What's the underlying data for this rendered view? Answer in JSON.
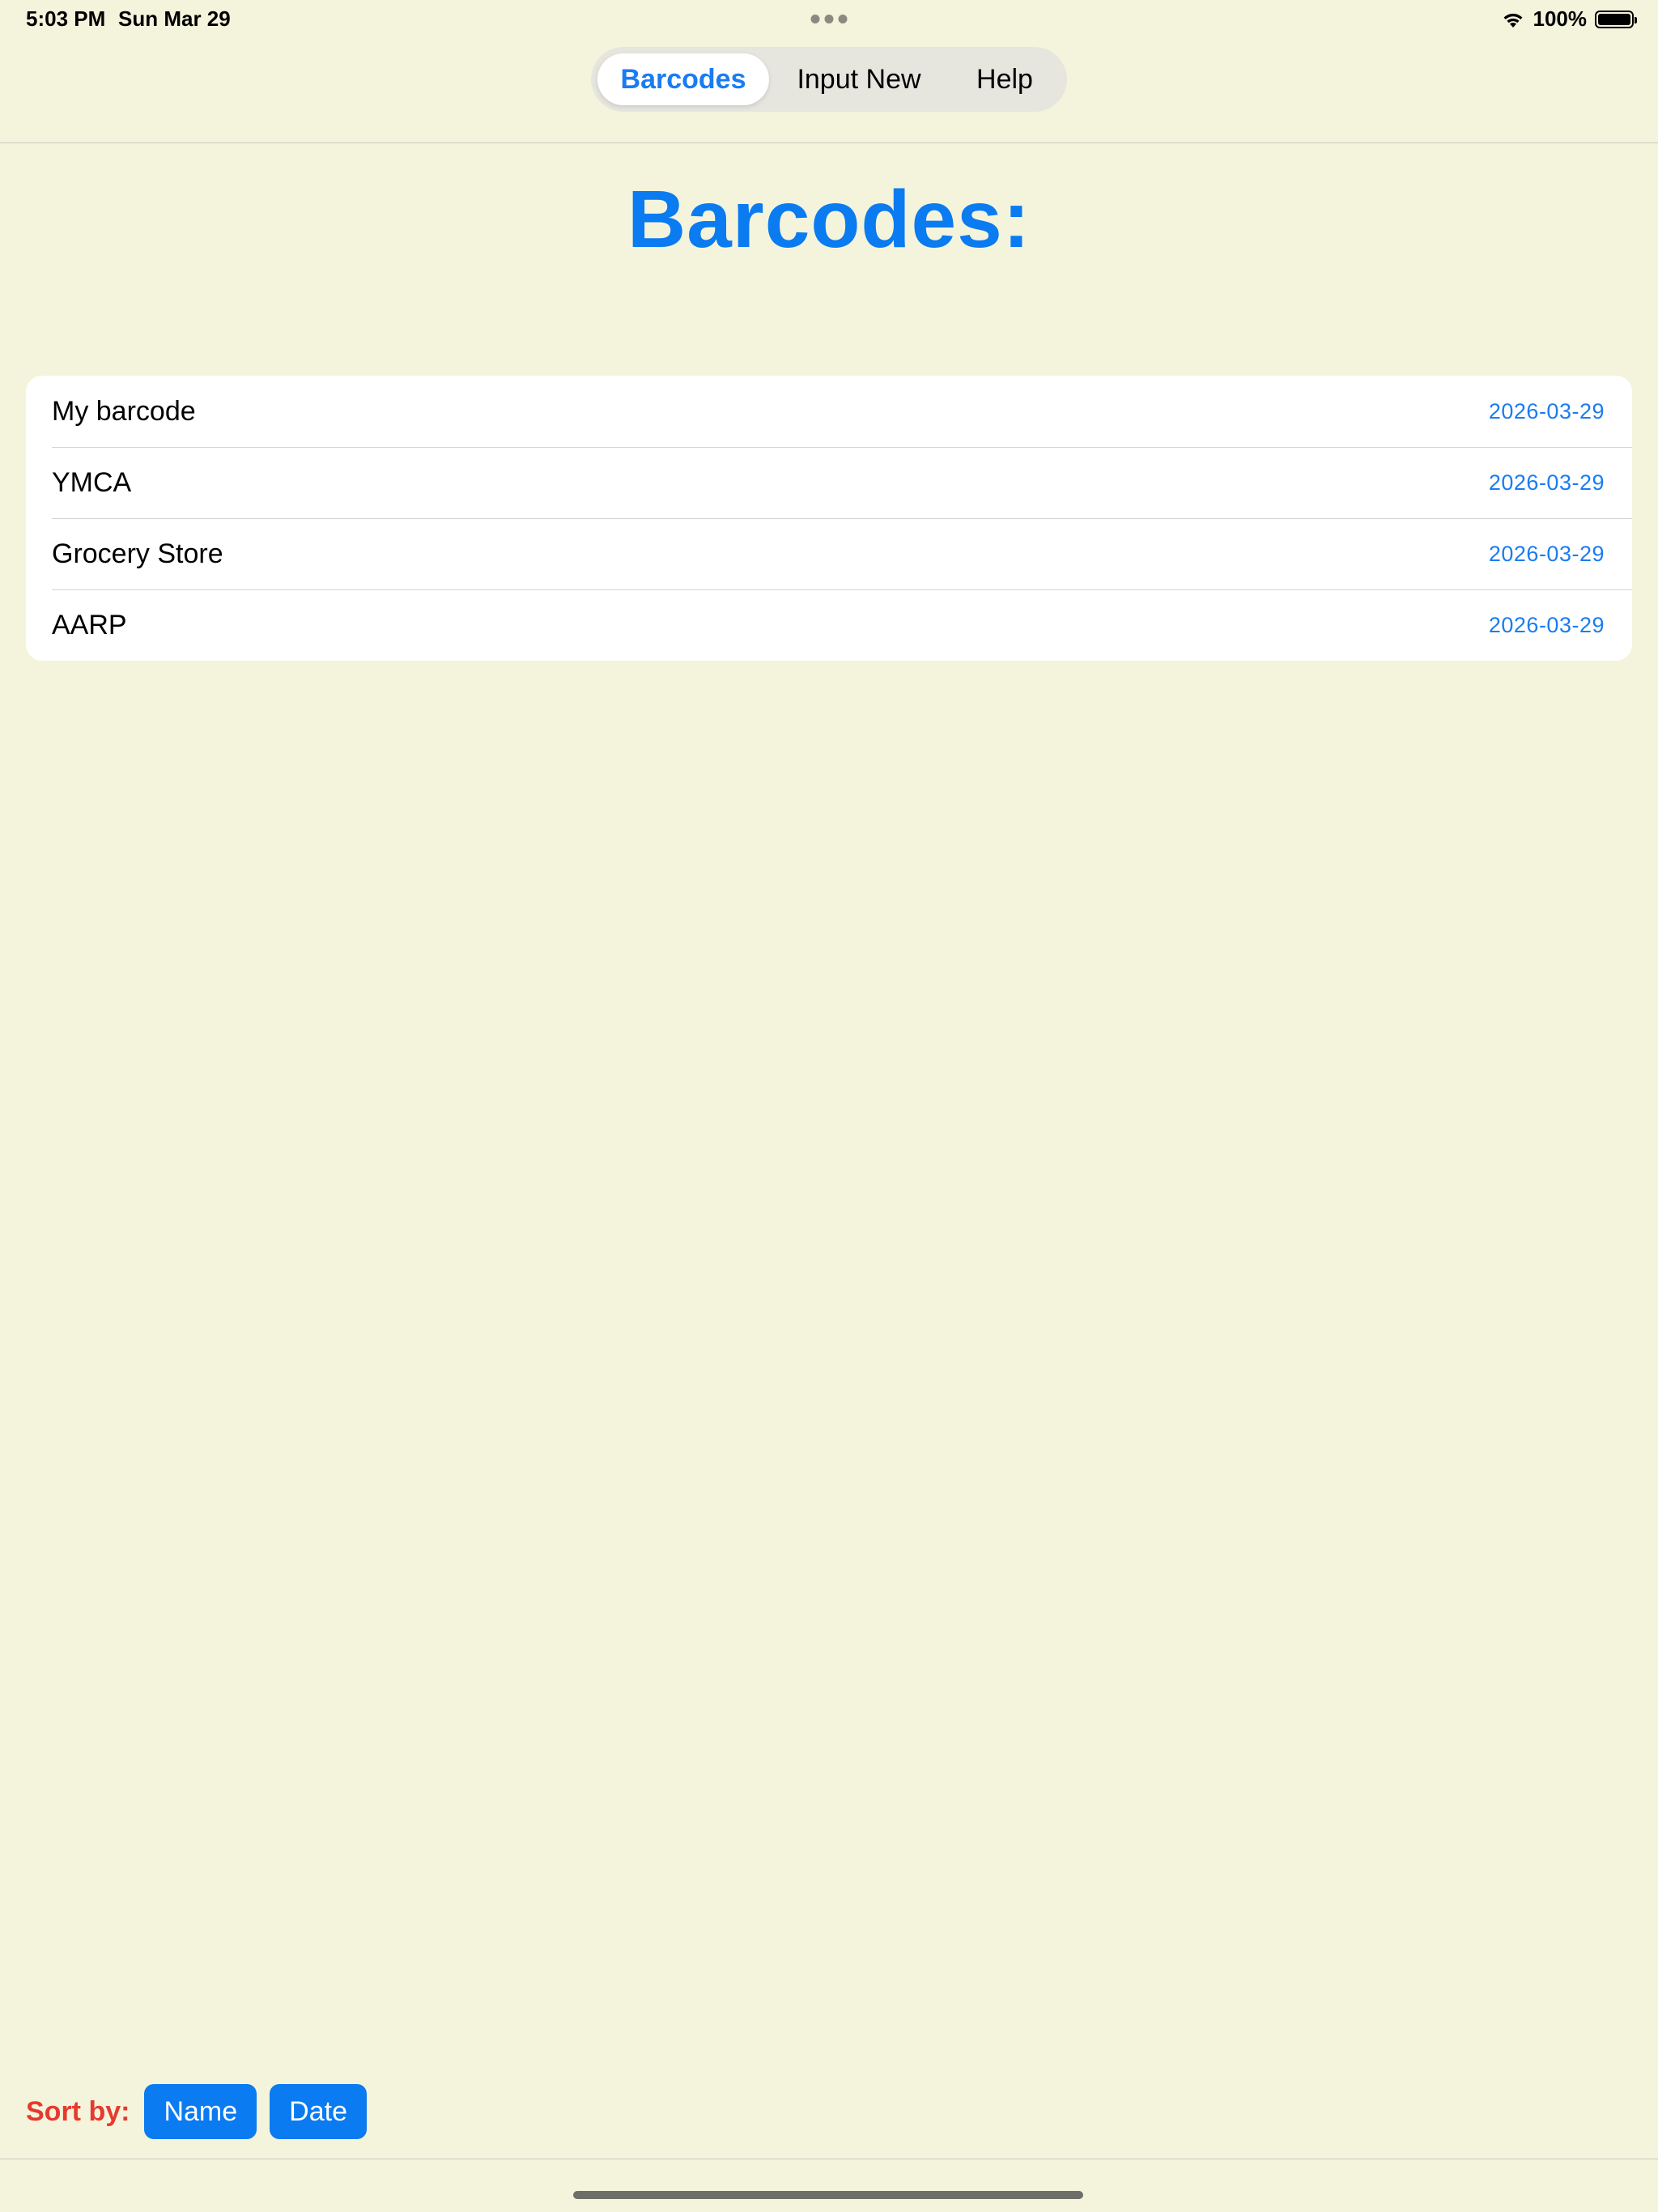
{
  "status_bar": {
    "time": "5:03 PM",
    "date": "Sun Mar 29",
    "battery_percent": "100%",
    "battery_level": 1.0,
    "icons": [
      "wifi-icon",
      "battery-icon",
      "multitask-dots-icon"
    ]
  },
  "tabs": [
    {
      "label": "Barcodes",
      "selected": true
    },
    {
      "label": "Input New",
      "selected": false
    },
    {
      "label": "Help",
      "selected": false
    }
  ],
  "page": {
    "title": "Barcodes:"
  },
  "barcodes": [
    {
      "name": "My barcode",
      "date": "2026-03-29"
    },
    {
      "name": "YMCA",
      "date": "2026-03-29"
    },
    {
      "name": "Grocery Store",
      "date": "2026-03-29"
    },
    {
      "name": "AARP",
      "date": "2026-03-29"
    }
  ],
  "sort": {
    "label": "Sort by:",
    "name_button": "Name",
    "date_button": "Date"
  },
  "colors": {
    "background": "#f4f4dc",
    "accent": "#0a7bf0",
    "sort_label": "#e8392f"
  }
}
